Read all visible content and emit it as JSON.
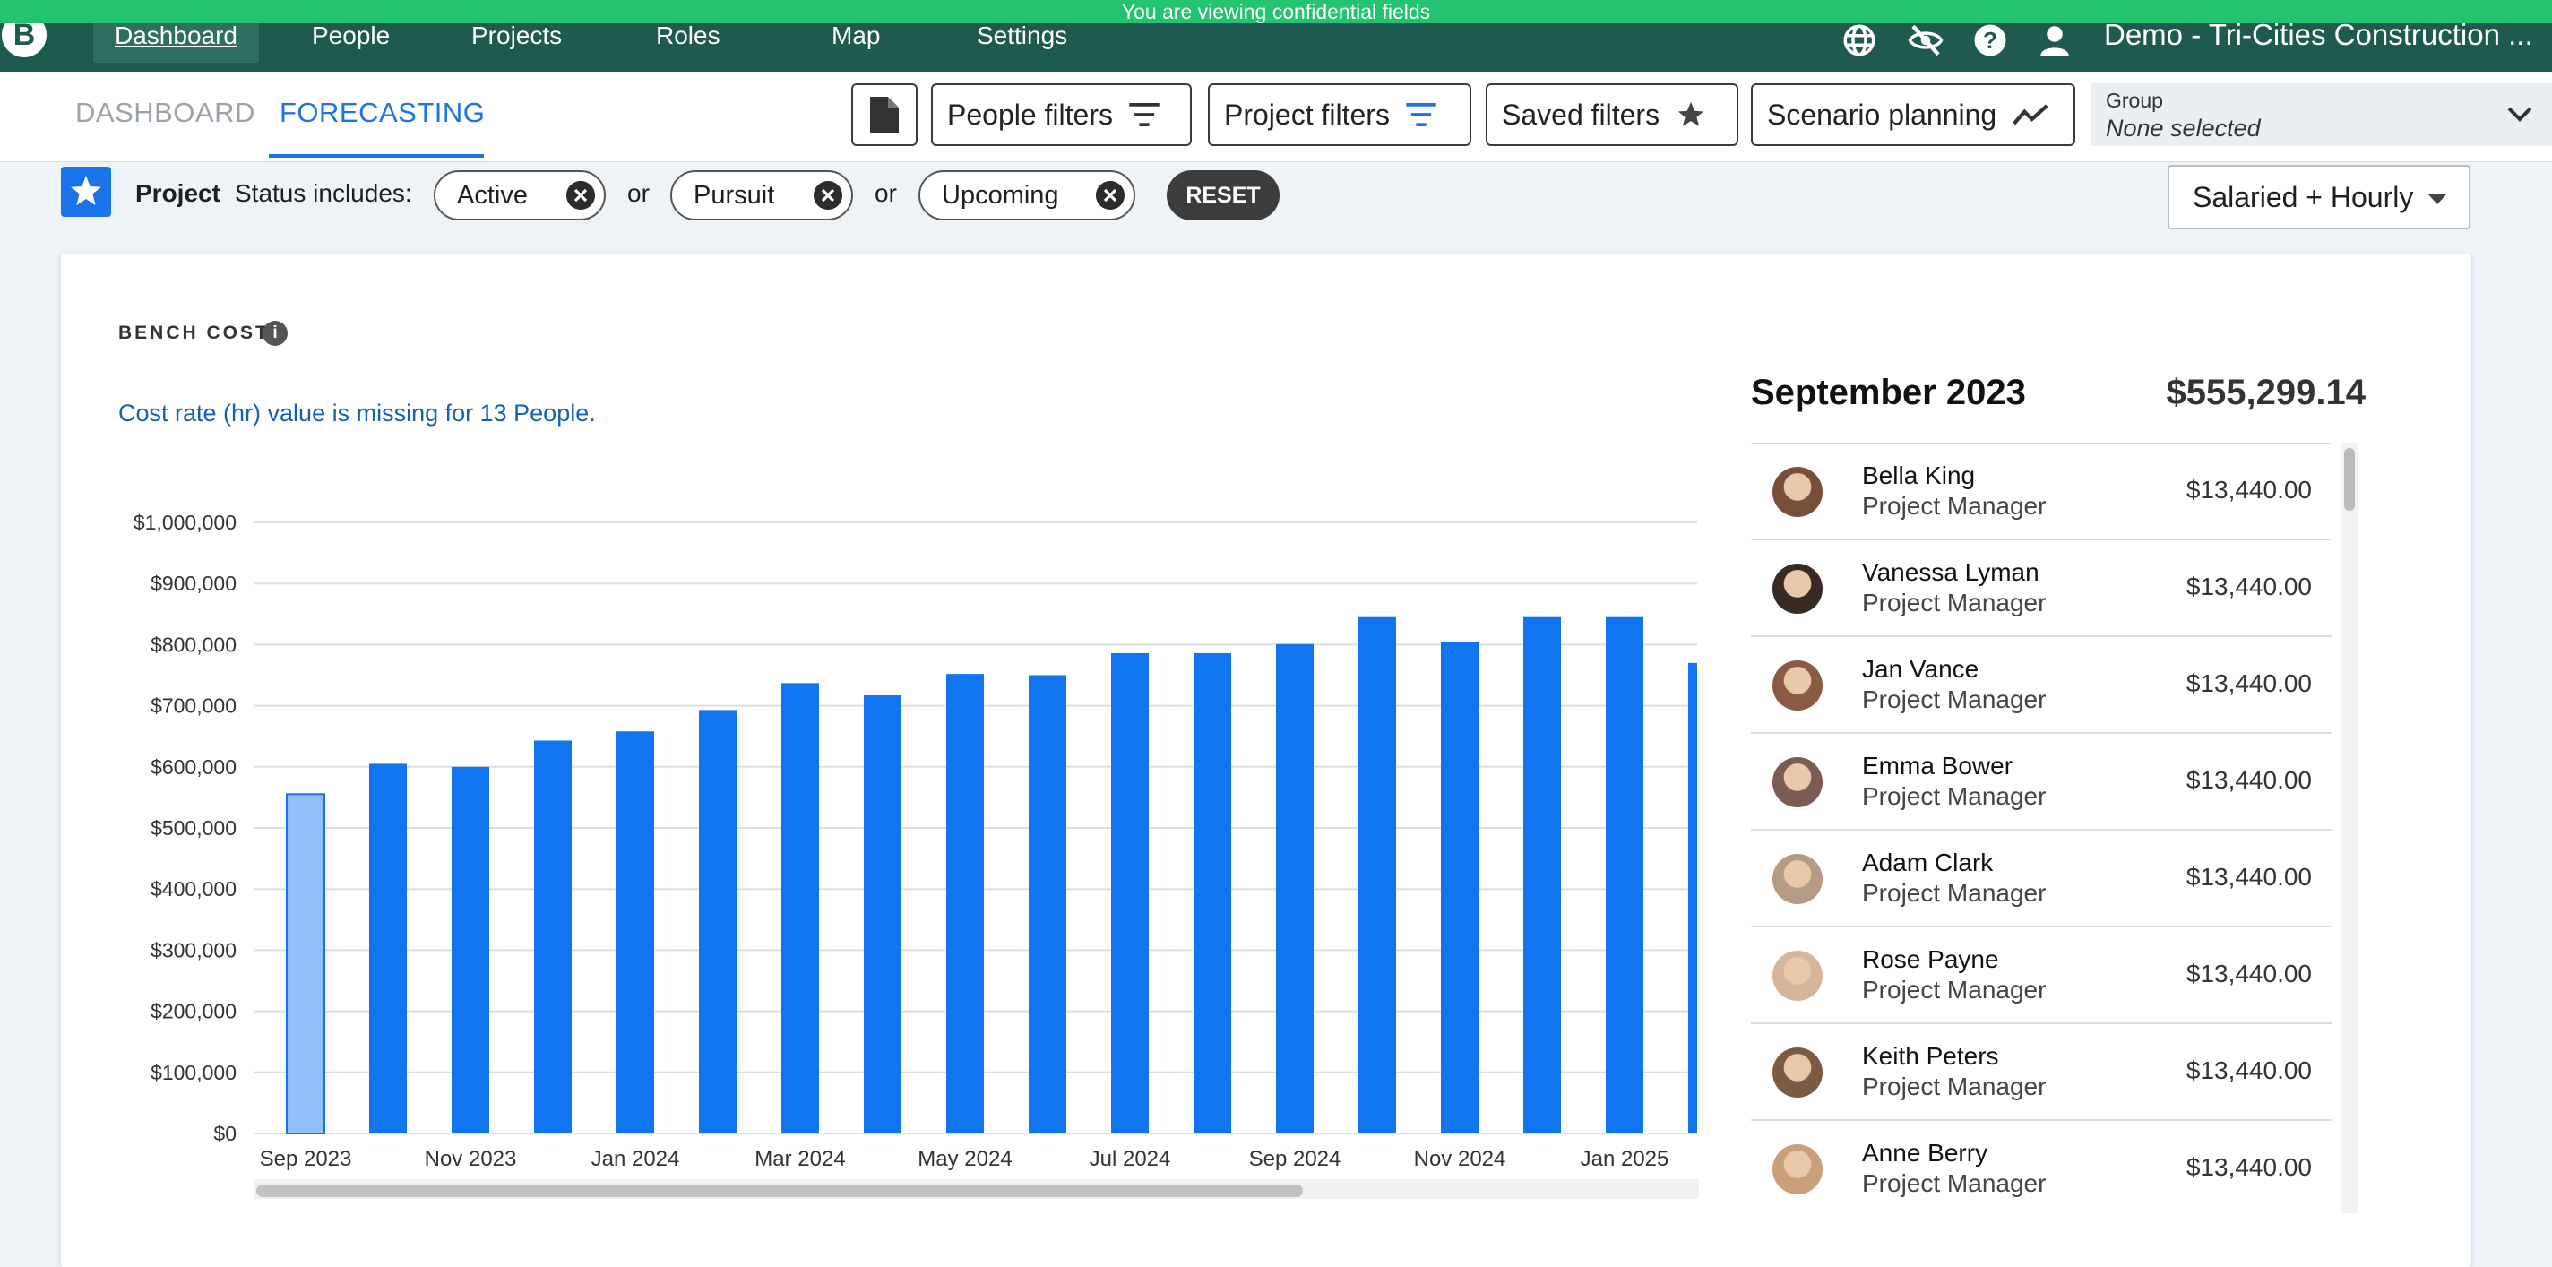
{
  "banner": "You are viewing confidential fields",
  "nav": {
    "logo": "B",
    "items": [
      "Dashboard",
      "People",
      "Projects",
      "Roles",
      "Map",
      "Settings"
    ],
    "active": "Dashboard",
    "icons": [
      "globe-icon",
      "eye-off-icon",
      "help-icon",
      "account-icon"
    ],
    "org": "Demo - Tri-Cities Construction ..."
  },
  "subtabs": {
    "dashboard": "DASHBOARD",
    "forecasting": "FORECASTING",
    "active": "FORECASTING"
  },
  "toolbar": {
    "report_icon": "document-icon",
    "people_filters": "People filters",
    "project_filters": "Project filters",
    "saved_filters": "Saved filters",
    "scenario_planning": "Scenario planning"
  },
  "group": {
    "label": "Group",
    "value": "None selected"
  },
  "filter": {
    "entity": "Project",
    "field": "Status includes:",
    "chips": [
      "Active",
      "Pursuit",
      "Upcoming"
    ],
    "joiner": "or",
    "reset": "RESET"
  },
  "pay_type": "Salaried + Hourly",
  "card": {
    "title": "BENCH COST",
    "info": "i",
    "warning": "Cost rate (hr) value is missing for 13 People."
  },
  "summary": {
    "month": "September 2023",
    "total": "$555,299.14"
  },
  "people": [
    {
      "name": "Bella King",
      "role": "Project Manager",
      "cost": "$13,440.00",
      "avatar": "#7a4f3a"
    },
    {
      "name": "Vanessa Lyman",
      "role": "Project Manager",
      "cost": "$13,440.00",
      "avatar": "#3a2a24"
    },
    {
      "name": "Jan Vance",
      "role": "Project Manager",
      "cost": "$13,440.00",
      "avatar": "#8a5a44"
    },
    {
      "name": "Emma Bower",
      "role": "Project Manager",
      "cost": "$13,440.00",
      "avatar": "#7b5c52"
    },
    {
      "name": "Adam Clark",
      "role": "Project Manager",
      "cost": "$13,440.00",
      "avatar": "#b59a86"
    },
    {
      "name": "Rose Payne",
      "role": "Project Manager",
      "cost": "$13,440.00",
      "avatar": "#d6b59a"
    },
    {
      "name": "Keith Peters",
      "role": "Project Manager",
      "cost": "$13,440.00",
      "avatar": "#7d5a44"
    },
    {
      "name": "Anne Berry",
      "role": "Project Manager",
      "cost": "$13,440.00",
      "avatar": "#c9a07a"
    }
  ],
  "chart_data": {
    "type": "bar",
    "title": "BENCH COST",
    "categories": [
      "Sep 2023",
      "Oct 2023",
      "Nov 2023",
      "Dec 2023",
      "Jan 2024",
      "Feb 2024",
      "Mar 2024",
      "Apr 2024",
      "May 2024",
      "Jun 2024",
      "Jul 2024",
      "Aug 2024",
      "Sep 2024",
      "Oct 2024",
      "Nov 2024",
      "Dec 2024",
      "Jan 2025",
      "Feb 2025"
    ],
    "values": [
      555299.14,
      605000,
      600000,
      643000,
      658000,
      693000,
      737000,
      717000,
      752000,
      750000,
      786000,
      786000,
      801000,
      845000,
      805000,
      845000,
      845000,
      770000
    ],
    "selected_index": 0,
    "ylim": [
      0,
      1000000
    ],
    "yticks": [
      "$0",
      "$100,000",
      "$200,000",
      "$300,000",
      "$400,000",
      "$500,000",
      "$600,000",
      "$700,000",
      "$800,000",
      "$900,000",
      "$1,000,000"
    ],
    "xtick_labels": [
      "Sep 2023",
      "Nov 2023",
      "Jan 2024",
      "Mar 2024",
      "May 2024",
      "Jul 2024",
      "Sep 2024",
      "Nov 2024",
      "Jan 2025"
    ],
    "grid": true,
    "colors": {
      "bar": "#1275f0",
      "selected": "#94bdfb"
    }
  }
}
